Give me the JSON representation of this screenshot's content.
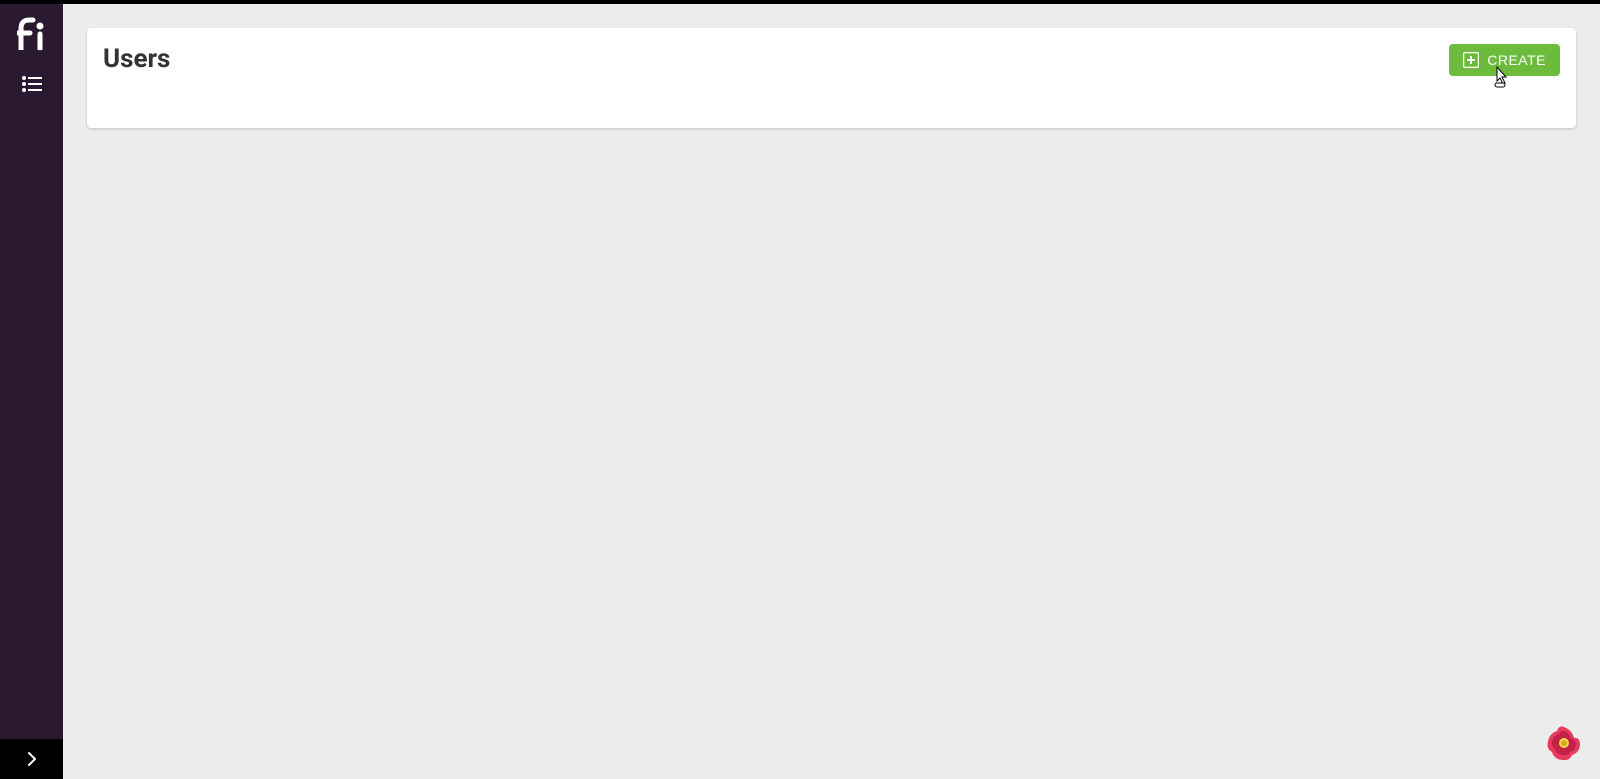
{
  "header": {
    "page_title": "Users",
    "create_button_label": "CREATE"
  },
  "sidebar": {
    "logo_text": "fi"
  },
  "colors": {
    "sidebar_bg": "#2b1932",
    "accent_green": "#6cbb3c",
    "main_bg": "#ececec",
    "badge_red": "#e83a5e",
    "badge_green": "#6a9a3a"
  }
}
